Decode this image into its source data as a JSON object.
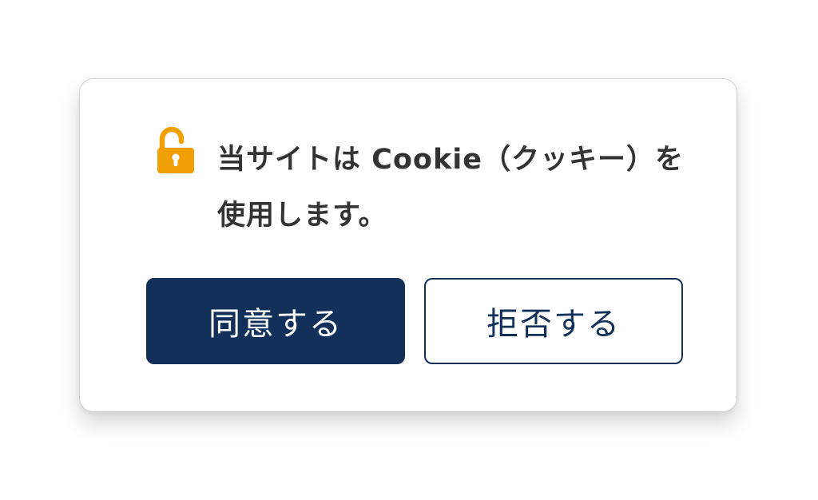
{
  "dialog": {
    "message": "当サイトは Cookie（クッキー）を使用します。",
    "icon": "unlocked-padlock-icon",
    "accept_label": "同意する",
    "reject_label": "拒否する"
  },
  "colors": {
    "icon": "#f2a007",
    "primary": "#12305a",
    "text": "#333333",
    "border": "#d2d2d2"
  }
}
